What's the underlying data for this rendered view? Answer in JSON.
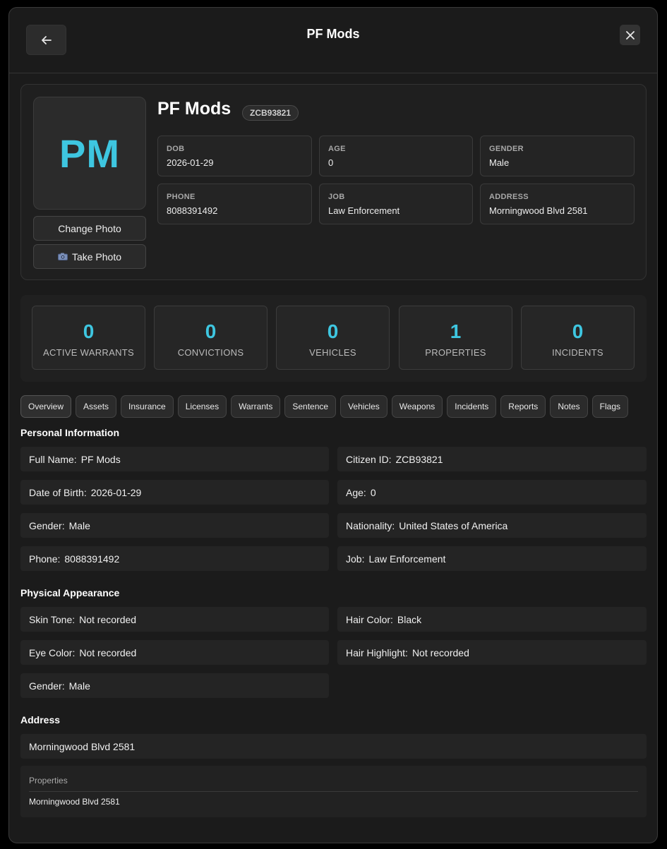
{
  "header": {
    "title": "PF Mods"
  },
  "profile": {
    "initials": "PM",
    "name": "PF Mods",
    "citizen_id": "ZCB93821",
    "change_photo_label": "Change Photo",
    "take_photo_label": "Take Photo",
    "fields": [
      {
        "label": "DOB",
        "value": "2026-01-29"
      },
      {
        "label": "AGE",
        "value": "0"
      },
      {
        "label": "GENDER",
        "value": "Male"
      },
      {
        "label": "PHONE",
        "value": "8088391492"
      },
      {
        "label": "JOB",
        "value": "Law Enforcement"
      },
      {
        "label": "ADDRESS",
        "value": "Morningwood Blvd 2581"
      }
    ]
  },
  "stats": [
    {
      "value": "0",
      "label": "ACTIVE WARRANTS"
    },
    {
      "value": "0",
      "label": "CONVICTIONS"
    },
    {
      "value": "0",
      "label": "VEHICLES"
    },
    {
      "value": "1",
      "label": "PROPERTIES"
    },
    {
      "value": "0",
      "label": "INCIDENTS"
    }
  ],
  "tabs": [
    "Overview",
    "Assets",
    "Insurance",
    "Licenses",
    "Warrants",
    "Sentence",
    "Vehicles",
    "Weapons",
    "Incidents",
    "Reports",
    "Notes",
    "Flags"
  ],
  "personal": {
    "title": "Personal Information",
    "fields": [
      {
        "k": "Full Name:",
        "v": "PF Mods"
      },
      {
        "k": "Citizen ID:",
        "v": "ZCB93821"
      },
      {
        "k": "Date of Birth:",
        "v": "2026-01-29"
      },
      {
        "k": "Age:",
        "v": "0"
      },
      {
        "k": "Gender:",
        "v": "Male"
      },
      {
        "k": "Nationality:",
        "v": "United States of America"
      },
      {
        "k": "Phone:",
        "v": "8088391492"
      },
      {
        "k": "Job:",
        "v": "Law Enforcement"
      }
    ]
  },
  "physical": {
    "title": "Physical Appearance",
    "fields": [
      {
        "k": "Skin Tone:",
        "v": "Not recorded"
      },
      {
        "k": "Hair Color:",
        "v": "Black"
      },
      {
        "k": "Eye Color:",
        "v": "Not recorded"
      },
      {
        "k": "Hair Highlight:",
        "v": "Not recorded"
      },
      {
        "k": "Gender:",
        "v": "Male"
      }
    ]
  },
  "address": {
    "title": "Address",
    "value": "Morningwood Blvd 2581",
    "properties_title": "Properties",
    "properties": [
      "Morningwood Blvd 2581"
    ]
  },
  "colors": {
    "accent": "#3ec6e0",
    "background": "#1b1b1b"
  }
}
